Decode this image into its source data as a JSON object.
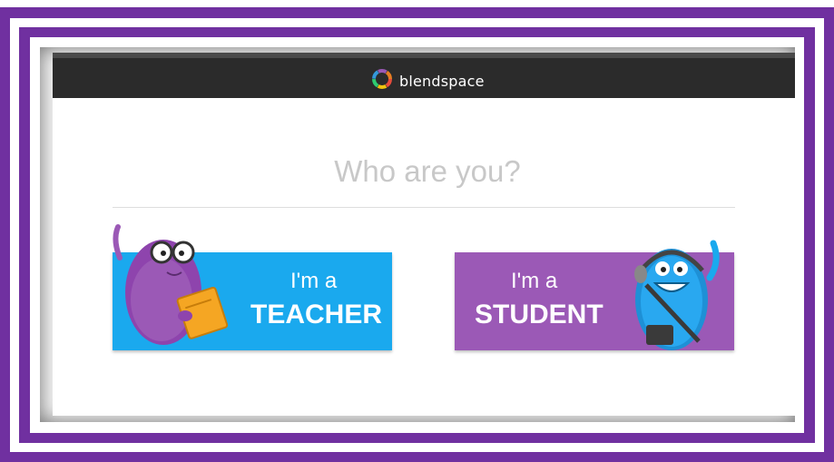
{
  "header": {
    "logo_text": "blendspace"
  },
  "main": {
    "title": "Who are you?",
    "teacher_button": {
      "line1": "I'm a",
      "line2": "TEACHER"
    },
    "student_button": {
      "line1": "I'm a",
      "line2": "STUDENT"
    }
  },
  "colors": {
    "frame_purple": "#7030a0",
    "header_bar": "#2b2b2b",
    "teacher_blue": "#1aa9ee",
    "student_purple": "#9b59b6"
  },
  "icons": [
    "blendspace-logo-icon",
    "teacher-character-icon",
    "student-character-icon"
  ]
}
